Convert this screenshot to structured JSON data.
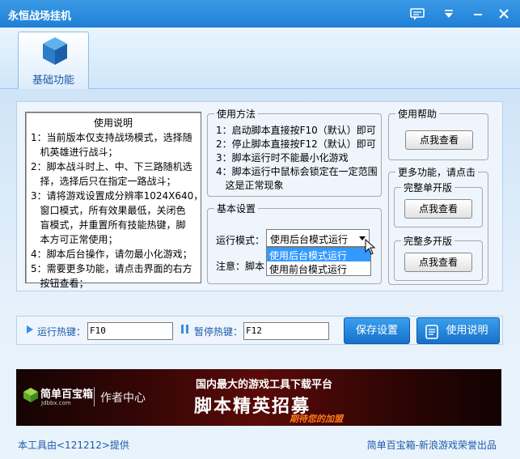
{
  "window": {
    "title": "永恒战场挂机"
  },
  "tabs": [
    {
      "label": "基础功能"
    }
  ],
  "help_text": {
    "title": "使用说明",
    "lines": [
      "1：当前版本仅支持战场模式，选择随",
      "   机英雄进行战斗；",
      "2：脚本战斗时上、中、下三路随机选",
      "   择，选择后只在指定一路战斗；",
      "3：请将游戏设置成分辨率1024X640，",
      "   窗口模式，所有效果最低，关闭色",
      "   盲模式，并重置所有技能热键，脚",
      "   本方可正常使用；",
      "4：脚本后台操作，请勿最小化游戏；",
      "5：需要更多功能，请点击界面的右方",
      "   按钮查看；"
    ]
  },
  "usage": {
    "title": "使用方法",
    "lines": [
      "1：启动脚本直接按F10（默认）即可",
      "2：停止脚本直接按F12（默认）即可",
      "3：脚本运行时不能最小化游戏",
      "4：脚本运行中鼠标会锁定在一定范围",
      "   这是正常现象"
    ]
  },
  "basic": {
    "title": "基本设置",
    "mode_label": "运行模式：",
    "mode_value": "使用后台模式运行",
    "options": [
      "使用后台模式运行",
      "使用前台模式运行"
    ],
    "note_label": "注意：脚本"
  },
  "usehelp": {
    "title": "使用帮助",
    "button": "点我查看"
  },
  "more": {
    "title": "更多功能，请点击",
    "single": {
      "title": "完整单开版",
      "button": "点我查看"
    },
    "multi": {
      "title": "完整多开版",
      "button": "点我查看"
    }
  },
  "hotkeys": {
    "run_label": "运行热键：",
    "run_value": "F10",
    "pause_label": "暂停热键：",
    "pause_value": "F12"
  },
  "buttons": {
    "save": "保存设置",
    "manual": "使用说明"
  },
  "banner": {
    "logo": "简单百宝箱",
    "logo_sub": "Jdbbx.com",
    "author": "作者中心",
    "line1": "国内最大的游戏工具下载平台",
    "line2": "脚本精英招募",
    "line3": "期待您的加盟"
  },
  "footer": {
    "left": "本工具由<121212>提供",
    "right": "简单百宝箱-新浪游戏荣誉出品"
  },
  "colors": {
    "titlebar": "#2a8ae0",
    "accent": "#1e5aa8",
    "selection": "#3399ff"
  }
}
